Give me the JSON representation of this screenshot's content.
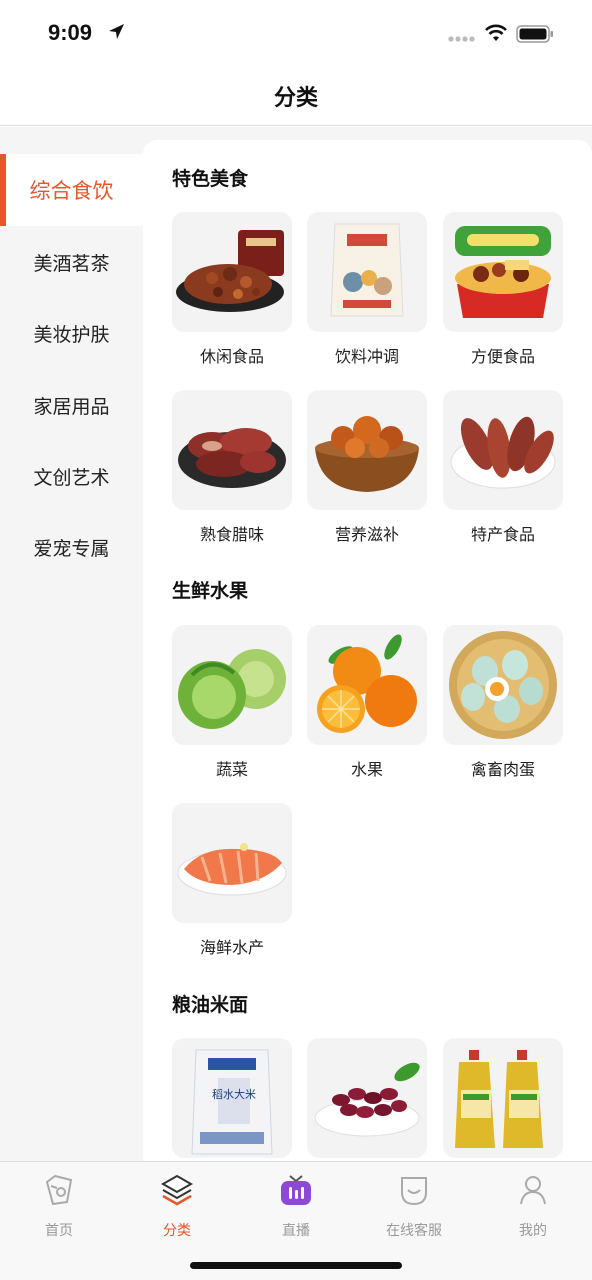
{
  "status_bar": {
    "time": "9:09"
  },
  "nav": {
    "title": "分类"
  },
  "sidebar": {
    "items": [
      {
        "label": "综合食饮",
        "active": true
      },
      {
        "label": "美酒茗茶",
        "active": false
      },
      {
        "label": "美妆护肤",
        "active": false
      },
      {
        "label": "家居用品",
        "active": false
      },
      {
        "label": "文创艺术",
        "active": false
      },
      {
        "label": "爱宠专属",
        "active": false
      }
    ]
  },
  "sections": [
    {
      "title": "特色美食",
      "items": [
        {
          "label": "休闲食品",
          "image": "snack-image"
        },
        {
          "label": "饮料冲调",
          "image": "drink-mix-image"
        },
        {
          "label": "方便食品",
          "image": "instant-food-image"
        },
        {
          "label": "熟食腊味",
          "image": "cured-meat-image"
        },
        {
          "label": "营养滋补",
          "image": "nutrition-image"
        },
        {
          "label": "特产食品",
          "image": "sweet-potato-image"
        }
      ]
    },
    {
      "title": "生鲜水果",
      "items": [
        {
          "label": "蔬菜",
          "image": "cabbage-image"
        },
        {
          "label": "水果",
          "image": "orange-image"
        },
        {
          "label": "禽畜肉蛋",
          "image": "eggs-image"
        },
        {
          "label": "海鲜水产",
          "image": "salmon-image"
        }
      ]
    },
    {
      "title": "粮油米面",
      "items": [
        {
          "label": "",
          "image": "rice-bag-image",
          "bag_text": "稻水大米"
        },
        {
          "label": "",
          "image": "red-beans-image"
        },
        {
          "label": "",
          "image": "oil-bottles-image"
        }
      ]
    }
  ],
  "tab_bar": {
    "tabs": [
      {
        "label": "首页",
        "icon": "home-icon",
        "active": false
      },
      {
        "label": "分类",
        "icon": "category-icon",
        "active": true
      },
      {
        "label": "直播",
        "icon": "live-tv-icon",
        "active": false
      },
      {
        "label": "在线客服",
        "icon": "customer-service-icon",
        "active": false
      },
      {
        "label": "我的",
        "icon": "profile-icon",
        "active": false
      }
    ]
  },
  "colors": {
    "accent": "#e8552a",
    "sidebar_bg": "#f5f5f5",
    "tile_bg": "#f3f3f3",
    "tab_inactive": "#9a9a9a"
  }
}
